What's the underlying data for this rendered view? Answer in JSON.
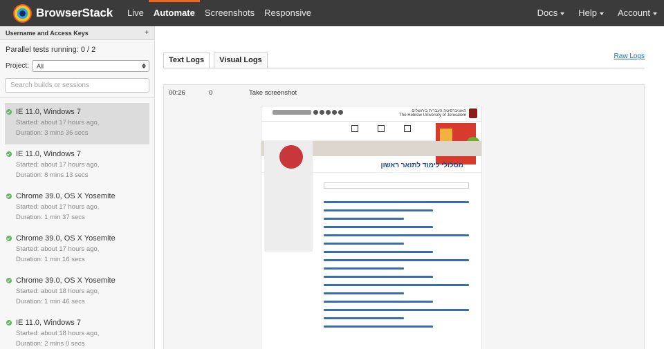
{
  "brand": {
    "name": "BrowserStack"
  },
  "nav": {
    "left": [
      "Live",
      "Automate",
      "Screenshots",
      "Responsive"
    ],
    "active": "Automate",
    "right": [
      "Docs",
      "Help",
      "Account"
    ]
  },
  "sidebar": {
    "header": "Username and Access Keys",
    "header_action": "+",
    "parallel_text": "Parallel tests running: 0 / 2",
    "project_label": "Project:",
    "project_value": "All",
    "search_placeholder": "Search builds or sessions",
    "sessions": [
      {
        "title": "IE 11.0, Windows 7",
        "started": "Started: about 17 hours ago,",
        "duration": "Duration: 3 mins 36 secs",
        "selected": true
      },
      {
        "title": "IE 11.0, Windows 7",
        "started": "Started: about 17 hours ago,",
        "duration": "Duration: 8 mins 13 secs"
      },
      {
        "title": "Chrome 39.0, OS X Yosemite",
        "started": "Started: about 17 hours ago,",
        "duration": "Duration: 1 min 37 secs"
      },
      {
        "title": "Chrome 39.0, OS X Yosemite",
        "started": "Started: about 17 hours ago,",
        "duration": "Duration: 1 min 16 secs"
      },
      {
        "title": "Chrome 39.0, OS X Yosemite",
        "started": "Started: about 18 hours ago,",
        "duration": "Duration: 1 min 46 secs"
      },
      {
        "title": "IE 11.0, Windows 7",
        "started": "Started: about 18 hours ago,",
        "duration": "Duration: 2 mins 0 secs"
      }
    ],
    "status_color": "#5cb85c"
  },
  "main": {
    "tabs": [
      "Text Logs",
      "Visual Logs"
    ],
    "active_tab": "Text Logs",
    "raw_logs": "Raw Logs",
    "log": {
      "time": "00:26",
      "num": "0",
      "action": "Take screenshot"
    },
    "screenshot": {
      "university_he": "האוניברסיטה העברית בירושלים",
      "university_en": "The Hebrew University of Jerusalem",
      "title_he": "מסלולי לימוד לתואר ראשון"
    }
  },
  "accent_color": "#f26722",
  "link_color": "#2a6db4"
}
